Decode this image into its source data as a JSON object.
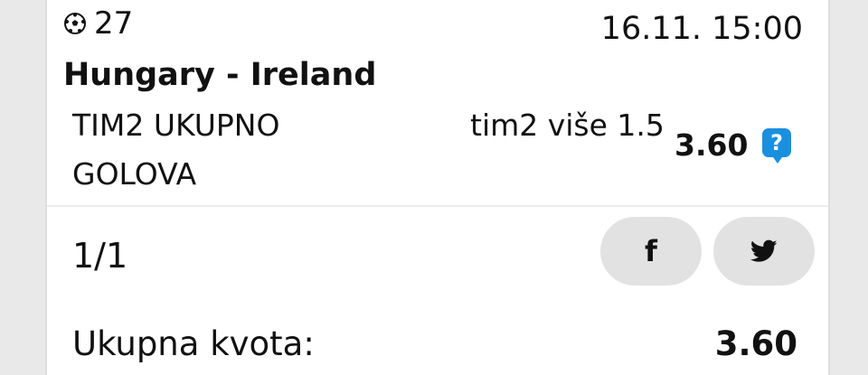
{
  "ticket": {
    "code": "27",
    "datetime": "16.11. 15:00",
    "match": "Hungary - Ireland",
    "market": "TIM2 UKUPNO GOLOVA",
    "pick": "tim2 više 1.5",
    "odd": "3.60",
    "help_icon": "?"
  },
  "summary": {
    "count": "1/1",
    "share": {
      "facebook_icon": "f",
      "twitter_icon": "twitter-bird"
    },
    "total_label": "Ukupna kvota:",
    "total_value": "3.60"
  },
  "colors": {
    "accent": "#1a8fe0",
    "share_bg": "#e2e2e2",
    "divider": "#ececec"
  }
}
